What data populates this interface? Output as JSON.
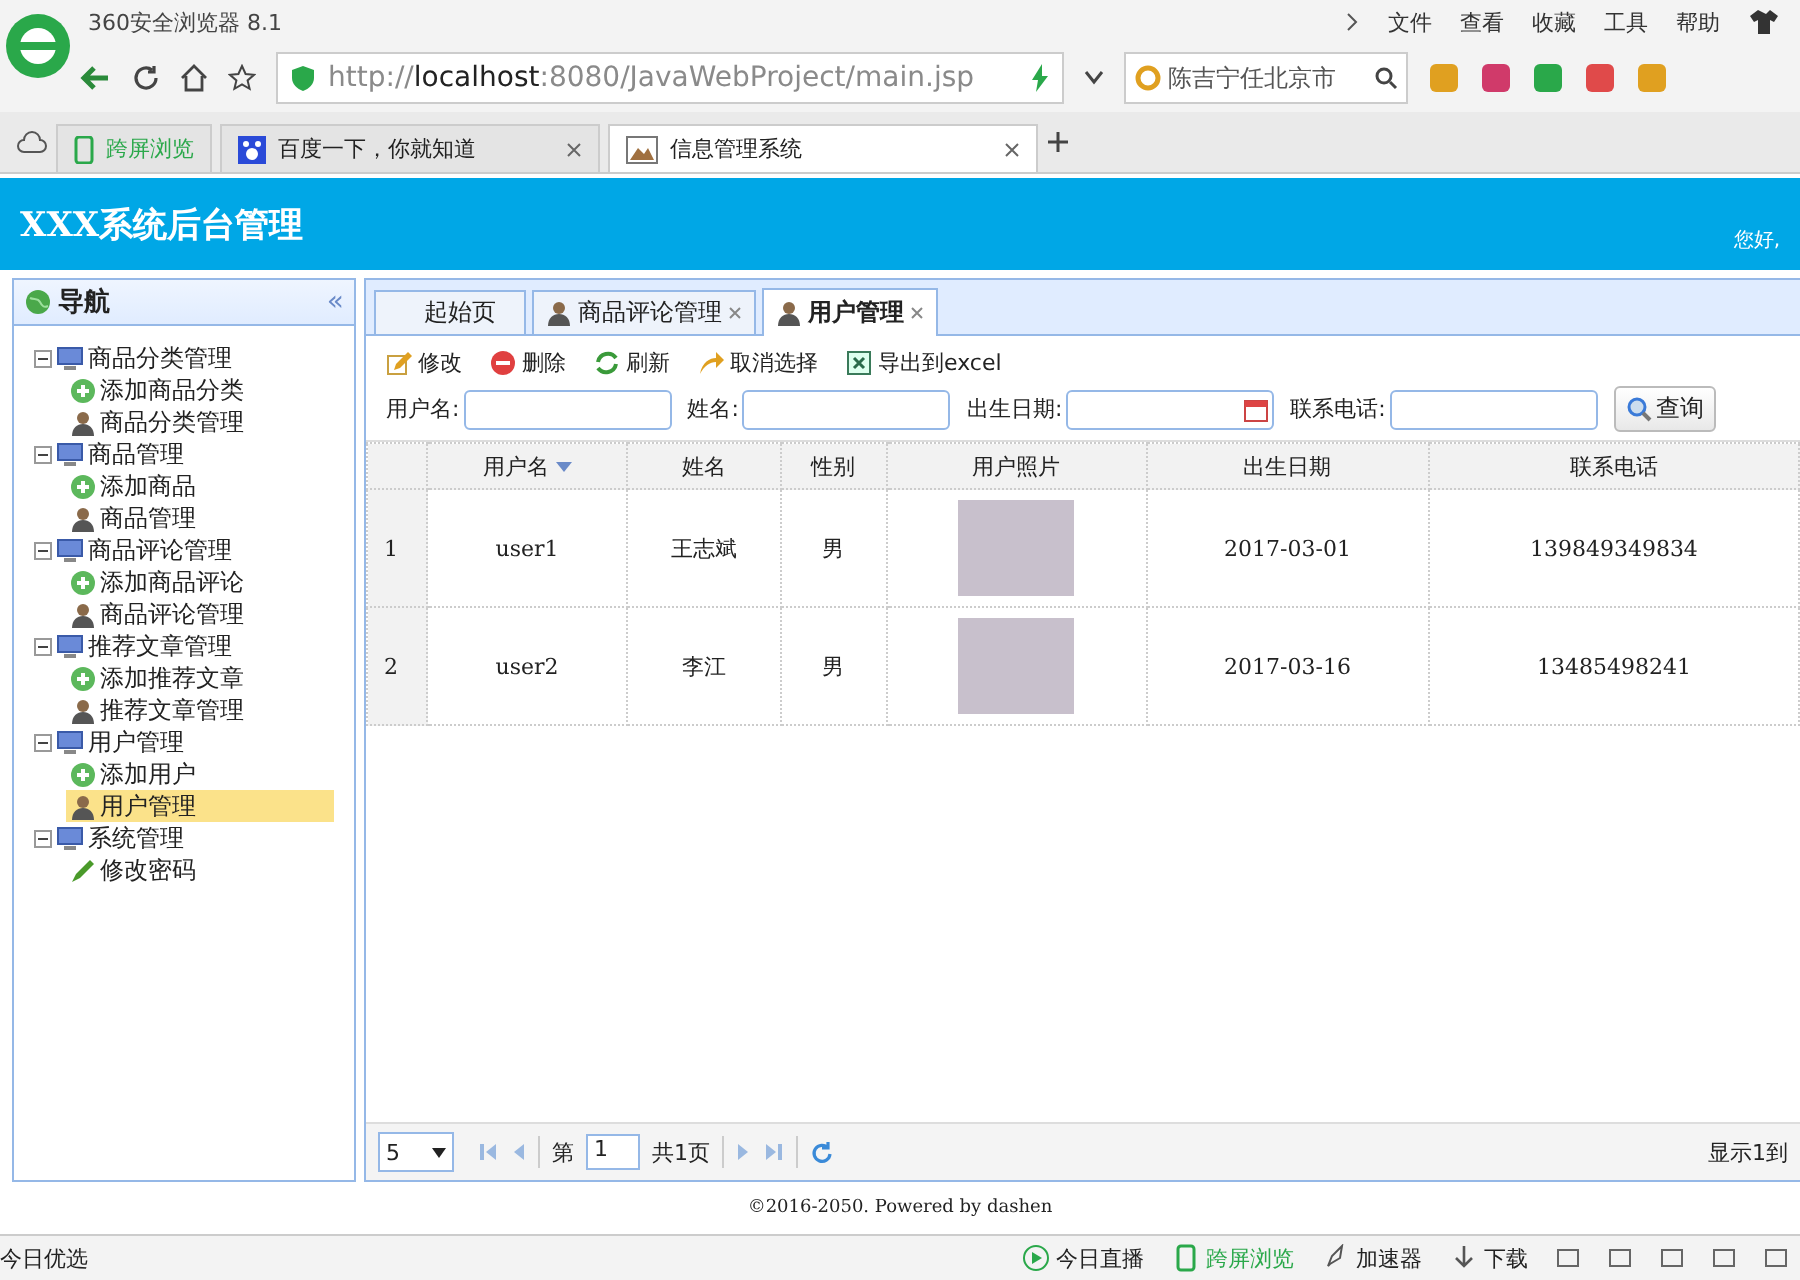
{
  "browser": {
    "title": "360安全浏览器 8.1",
    "menu": [
      "文件",
      "查看",
      "收藏",
      "工具",
      "帮助"
    ],
    "url_scheme": "http://",
    "url_host": "localhost",
    "url_rest": ":8080/JavaWebProject/main.jsp",
    "search": "陈吉宁任北京市",
    "tabs": [
      {
        "label": "跨屏浏览",
        "kind": "phone",
        "closable": false,
        "selected": false
      },
      {
        "label": "百度一下，你就知道",
        "kind": "paw",
        "closable": true,
        "selected": false
      },
      {
        "label": "信息管理系统",
        "kind": "chart",
        "closable": true,
        "selected": true
      }
    ],
    "status_left": "今日优选",
    "status_items": [
      "今日直播",
      "跨屏浏览",
      "加速器",
      "下载"
    ]
  },
  "app": {
    "title": "XXX系统后台管理",
    "greeting": "您好,"
  },
  "nav": {
    "title": "导航",
    "collapse": "«",
    "tree": [
      {
        "label": "商品分类管理",
        "expanded": true,
        "children": [
          {
            "label": "添加商品分类",
            "kind": "add",
            "selected": false
          },
          {
            "label": "商品分类管理",
            "kind": "user",
            "selected": false
          }
        ]
      },
      {
        "label": "商品管理",
        "expanded": true,
        "children": [
          {
            "label": "添加商品",
            "kind": "add",
            "selected": false
          },
          {
            "label": "商品管理",
            "kind": "user",
            "selected": false
          }
        ]
      },
      {
        "label": "商品评论管理",
        "expanded": true,
        "children": [
          {
            "label": "添加商品评论",
            "kind": "add",
            "selected": false
          },
          {
            "label": "商品评论管理",
            "kind": "user",
            "selected": false
          }
        ]
      },
      {
        "label": "推荐文章管理",
        "expanded": true,
        "children": [
          {
            "label": "添加推荐文章",
            "kind": "add",
            "selected": false
          },
          {
            "label": "推荐文章管理",
            "kind": "user",
            "selected": false
          }
        ]
      },
      {
        "label": "用户管理",
        "expanded": true,
        "children": [
          {
            "label": "添加用户",
            "kind": "add",
            "selected": false
          },
          {
            "label": "用户管理",
            "kind": "user",
            "selected": true
          }
        ]
      },
      {
        "label": "系统管理",
        "expanded": true,
        "children": [
          {
            "label": "修改密码",
            "kind": "pencil",
            "selected": false
          }
        ]
      }
    ]
  },
  "tabs": [
    {
      "label": "起始页",
      "icon": false,
      "closable": false,
      "selected": false
    },
    {
      "label": "商品评论管理",
      "icon": true,
      "closable": true,
      "selected": false
    },
    {
      "label": "用户管理",
      "icon": true,
      "closable": true,
      "selected": true
    }
  ],
  "toolbar": [
    {
      "label": "修改",
      "kind": "edit"
    },
    {
      "label": "删除",
      "kind": "delete"
    },
    {
      "label": "刷新",
      "kind": "refresh"
    },
    {
      "label": "取消选择",
      "kind": "undo"
    },
    {
      "label": "导出到excel",
      "kind": "export"
    }
  ],
  "search_form": {
    "fields": [
      {
        "label": "用户名:",
        "kind": "text"
      },
      {
        "label": "姓名:",
        "kind": "text"
      },
      {
        "label": "出生日期:",
        "kind": "date"
      },
      {
        "label": "联系电话:",
        "kind": "text"
      }
    ],
    "button": "查询"
  },
  "table": {
    "columns": [
      {
        "label": "用户名",
        "sorted": true
      },
      {
        "label": "姓名",
        "sorted": false
      },
      {
        "label": "性别",
        "sorted": false
      },
      {
        "label": "用户照片",
        "sorted": false
      },
      {
        "label": "出生日期",
        "sorted": false
      },
      {
        "label": "联系电话",
        "sorted": false
      }
    ],
    "rows": [
      {
        "index": "1",
        "cells": [
          "user1",
          "王志斌",
          "男",
          null,
          "2017-03-01",
          "139849349834"
        ]
      },
      {
        "index": "2",
        "cells": [
          "user2",
          "李江",
          "男",
          null,
          "2017-03-16",
          "13485498241"
        ]
      }
    ]
  },
  "pager": {
    "page_size": "5",
    "before": "第",
    "page": "1",
    "after": "共1页",
    "info": "显示1到"
  },
  "footer": "©2016-2050. Powered by dashen"
}
